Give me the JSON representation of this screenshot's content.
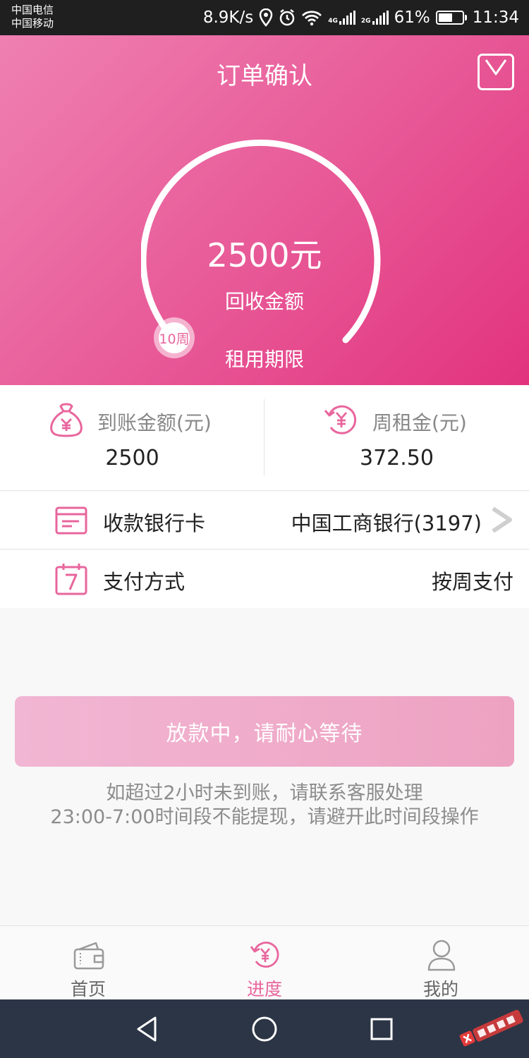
{
  "status_bar": {
    "carrier_1": "中国电信",
    "carrier_2": "中国移动",
    "speed": "8.9K/s",
    "network_1": "4G",
    "network_2": "2G",
    "battery": "61%",
    "time": "11:34"
  },
  "header": {
    "title": "订单确认"
  },
  "summary": {
    "amount": "2500元",
    "amount_label": "回收金额",
    "period_badge": "10周",
    "period_label": "租用期限"
  },
  "stats": {
    "received_label": "到账金额(元)",
    "received_value": "2500",
    "weekly_rent_label": "周租金(元)",
    "weekly_rent_value": "372.50"
  },
  "bank_row": {
    "label": "收款银行卡",
    "value": "中国工商银行(3197)"
  },
  "payment_row": {
    "label": "支付方式",
    "value": "按周支付"
  },
  "action": {
    "button_label": "放款中，请耐心等待",
    "note_1": "如超过2小时未到账，请联系客服处理",
    "note_2": "23:00-7:00时间段不能提现，请避开此时间段操作"
  },
  "tabs": [
    {
      "label": "首页",
      "icon": "wallet-icon",
      "active": false
    },
    {
      "label": "进度",
      "icon": "yen-refresh-icon",
      "active": true
    },
    {
      "label": "我的",
      "icon": "user-icon",
      "active": false
    }
  ],
  "colors": {
    "brand_pink": "#e8669d",
    "hero_gradient_start": "#ef80b1",
    "hero_gradient_end": "#e2337e",
    "button_pink": "#eea2c2",
    "nav_bar": "#2b3546"
  }
}
